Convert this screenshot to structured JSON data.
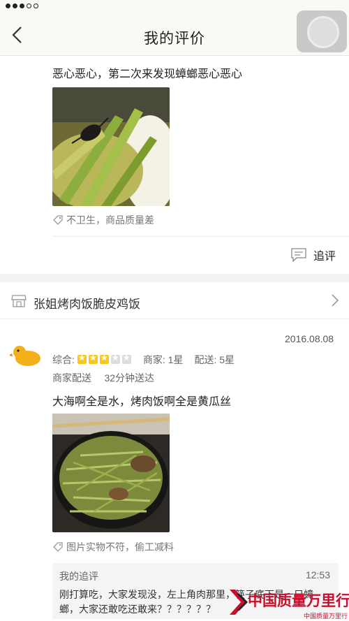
{
  "header": {
    "title": "我的评价"
  },
  "first_review": {
    "comment": "恶心恶心，第二次来发现蟑螂恶心恶心",
    "tags": "不卫生，商品质量差",
    "follow_up_label": "追评"
  },
  "second_review": {
    "shop_name": "张姐烤肉饭脆皮鸡饭",
    "date": "2016.08.08",
    "rating_label": "综合:",
    "rating_stars": 3,
    "rating_max": 5,
    "merchant_rating": "商家: 1星",
    "delivery_rating": "配送: 5星",
    "delivery_type": "商家配送",
    "delivery_time": "32分钟送达",
    "comment": "大海啊全是水，烤肉饭啊全是黄瓜丝",
    "tags": "图片实物不符，偷工减料",
    "reply": {
      "label": "我的追评",
      "time": "12:53",
      "text": "刚打算吃，大家发现没，左上角肉那里，筷子底下是一只蟑螂，大家还敢吃还敢来？？？？？？"
    }
  },
  "watermark": {
    "line1": "中国质量万里行",
    "line2": "中国质量万里行"
  },
  "colors": {
    "star_on": "#f7c81e",
    "star_off": "#dcdcdc",
    "navbar_bg": "#faf9f6"
  },
  "icons": {
    "back": "chevron-left-icon",
    "tag": "tag-icon",
    "follow_up": "message-icon",
    "shop": "shop-icon",
    "arrow": "chevron-right-icon",
    "avatar": "duck-avatar"
  }
}
